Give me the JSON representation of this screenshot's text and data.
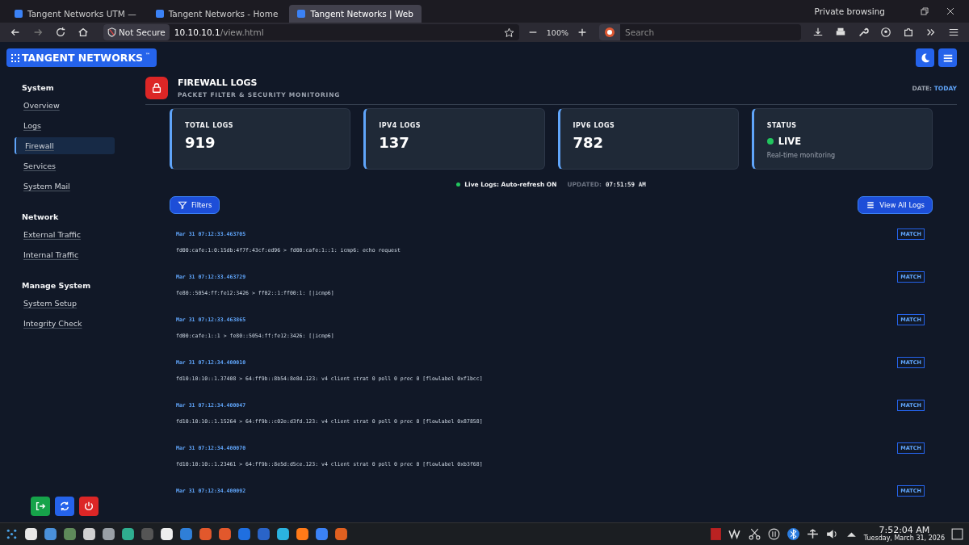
{
  "browser": {
    "tabs": [
      {
        "title": "Tangent Networks UTM —",
        "selected": false
      },
      {
        "title": "Tangent Networks - Home",
        "selected": false
      },
      {
        "title": "Tangent Networks | Web",
        "selected": true
      }
    ],
    "private_label": "Private browsing",
    "security": "Not Secure",
    "url_host": "10.10.10.1",
    "url_path": "/view.html",
    "zoom": "100%",
    "search": {
      "placeholder": "Search"
    }
  },
  "brand": {
    "name": "TANGENT NETWORKS",
    "mark": "™"
  },
  "sidebar": {
    "sections": [
      {
        "title": "System",
        "items": [
          {
            "label": "Overview",
            "selected": false
          },
          {
            "label": "Logs",
            "selected": false
          },
          {
            "label": "Firewall",
            "selected": true
          },
          {
            "label": "Services",
            "selected": false
          },
          {
            "label": "System Mail",
            "selected": false
          }
        ]
      },
      {
        "title": "Network",
        "items": [
          {
            "label": "External Traffic",
            "selected": false
          },
          {
            "label": "Internal Traffic",
            "selected": false
          }
        ]
      },
      {
        "title": "Manage System",
        "items": [
          {
            "label": "System Setup",
            "selected": false
          },
          {
            "label": "Integrity Check",
            "selected": false
          }
        ]
      }
    ]
  },
  "header": {
    "title": "FIREWALL LOGS",
    "subtitle": "PACKET FILTER & SECURITY MONITORING",
    "date_label": "DATE:",
    "date_value": "TODAY"
  },
  "stats": [
    {
      "kind": "count",
      "label": "TOTAL LOGS",
      "value": "919"
    },
    {
      "kind": "count",
      "label": "IPV4 LOGS",
      "value": "137"
    },
    {
      "kind": "count",
      "label": "IPV6 LOGS",
      "value": "782"
    },
    {
      "kind": "status",
      "label": "STATUS",
      "value": "LIVE",
      "note": "Real-time monitoring"
    }
  ],
  "live": {
    "text": "Live Logs: Auto-refresh ON",
    "updated_label": "UPDATED:",
    "updated_time": "07:51:59 AM"
  },
  "buttons": {
    "filters": "Filters",
    "view_all": "View All Logs"
  },
  "logs": [
    {
      "time": "Mar 31 07:12:33.463705",
      "message": "fd00:cafe:1:0:15db:4f7f:43cf:ed96 > fd00:cafe:1::1: icmp6: echo request",
      "tag": "MATCH"
    },
    {
      "time": "Mar 31 07:12:33.463729",
      "message": "fe80::5054:ff:fe12:3426 > ff02::1:ff00:1: [|icmp6]",
      "tag": "MATCH"
    },
    {
      "time": "Mar 31 07:12:33.463865",
      "message": "fd00:cafe:1::1 > fe80::5054:ff:fe12:3426: [|icmp6]",
      "tag": "MATCH"
    },
    {
      "time": "Mar 31 07:12:34.400010",
      "message": "fd10:10:10::1.37408 > 64:ff9b::8b54:8e8d.123: v4 client strat 0 poll 0 prec 0 [flowlabel 0xf1bcc]",
      "tag": "MATCH"
    },
    {
      "time": "Mar 31 07:12:34.400047",
      "message": "fd10:10:10::1.15264 > 64:ff9b::c02e:d3fd.123: v4 client strat 0 poll 0 prec 0 [flowlabel 0x87858]",
      "tag": "MATCH"
    },
    {
      "time": "Mar 31 07:12:34.400070",
      "message": "fd10:10:10::1.23461 > 64:ff9b::8e5d:d5ce.123: v4 client strat 0 poll 0 prec 0 [flowlabel 0xb3f68]",
      "tag": "MATCH"
    },
    {
      "time": "Mar 31 07:12:34.400092",
      "tag": "MATCH"
    }
  ],
  "taskbar": {
    "time": "7:52:04 AM",
    "date": "Tuesday, March 31, 2026"
  }
}
